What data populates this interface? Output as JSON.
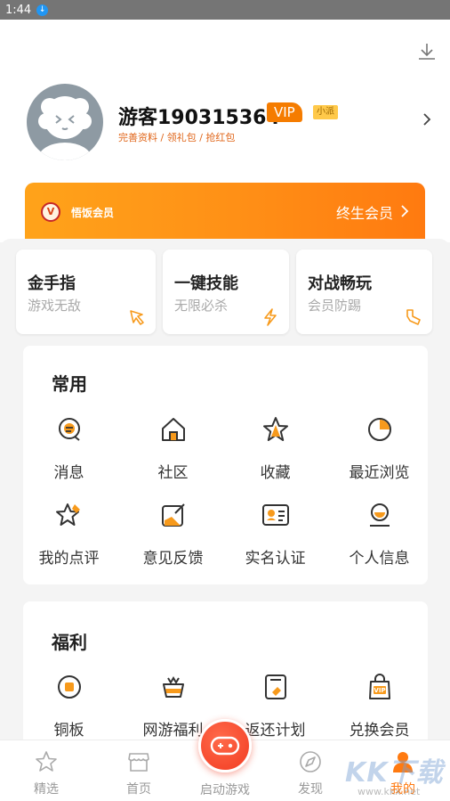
{
  "status_bar": {
    "time": "1:44"
  },
  "profile": {
    "username": "游客190315364",
    "vip_label": "VIP",
    "level_label": "小派",
    "sub_links": "完善资料 / 领礼包 / 抢红包"
  },
  "vip_banner": {
    "brand": "悟饭会员",
    "plan": "终生会员"
  },
  "features": [
    {
      "title": "金手指",
      "subtitle": "游戏无敌",
      "icon": "hand-pointer-icon"
    },
    {
      "title": "一键技能",
      "subtitle": "无限必杀",
      "icon": "lightning-icon"
    },
    {
      "title": "对战畅玩",
      "subtitle": "会员防踢",
      "icon": "kick-icon"
    }
  ],
  "common": {
    "title": "常用",
    "items": [
      {
        "label": "消息",
        "icon": "message-icon"
      },
      {
        "label": "社区",
        "icon": "community-icon"
      },
      {
        "label": "收藏",
        "icon": "star-icon"
      },
      {
        "label": "最近浏览",
        "icon": "history-icon"
      },
      {
        "label": "我的点评",
        "icon": "review-icon"
      },
      {
        "label": "意见反馈",
        "icon": "feedback-icon"
      },
      {
        "label": "实名认证",
        "icon": "id-card-icon"
      },
      {
        "label": "个人信息",
        "icon": "profile-icon"
      }
    ]
  },
  "welfare": {
    "title": "福利",
    "items": [
      {
        "label": "铜板",
        "icon": "coin-icon"
      },
      {
        "label": "网游福利",
        "icon": "gift-box-icon"
      },
      {
        "label": "返还计划",
        "icon": "rebate-icon"
      },
      {
        "label": "兑换会员",
        "icon": "vip-bag-icon"
      }
    ]
  },
  "bottom_nav": {
    "items": [
      {
        "label": "精选",
        "icon": "star-icon"
      },
      {
        "label": "首页",
        "icon": "store-icon"
      },
      {
        "label": "启动游戏",
        "icon": "gamepad-icon"
      },
      {
        "label": "发现",
        "icon": "compass-icon"
      },
      {
        "label": "我的",
        "icon": "person-icon"
      }
    ],
    "active": "我的"
  },
  "watermark": {
    "text": "KK下载",
    "sub": "www.kkx.net"
  },
  "colors": {
    "accent": "#ff7a10",
    "vip_orange": "#f57c00",
    "launch_red": "#f23c22"
  }
}
